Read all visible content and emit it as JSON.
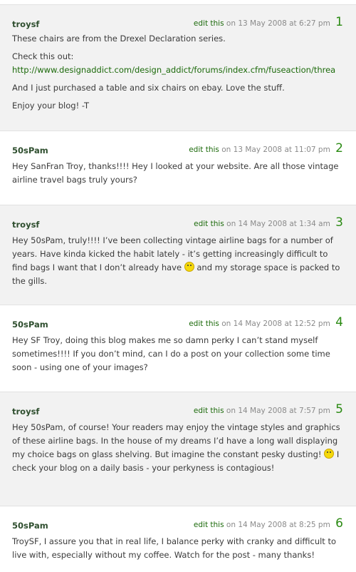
{
  "comments": [
    {
      "author": "troysf",
      "edit_label": "edit this",
      "date": "on 13 May 2008 at 6:27 pm",
      "number": "1",
      "p1": "These chairs are from the Drexel Declaration series.",
      "p2": "Check this out:",
      "link": "http://www.designaddict.com/design_addict/forums/index.cfm/fuseaction/threa",
      "p3": "And I just purchased a table and six chairs on ebay. Love the stuff.",
      "p4": "Enjoy your blog! -T"
    },
    {
      "author": "50sPam",
      "edit_label": "edit this",
      "date": "on 13 May 2008 at 11:07 pm",
      "number": "2",
      "p1": "Hey SanFran Troy, thanks!!!! Hey I looked at your website. Are all those vintage airline travel bags truly yours?"
    },
    {
      "author": "troysf",
      "edit_label": "edit this",
      "date": "on 14 May 2008 at 1:34 am",
      "number": "3",
      "p1a": "Hey 50sPam, truly!!!! I’ve been collecting vintage airline bags for a number of years. Have kinda kicked the habit lately - it’s getting increasingly difficult to find bags I want that I don’t already have",
      "p1b": "and my storage space is packed to the gills."
    },
    {
      "author": "50sPam",
      "edit_label": "edit this",
      "date": "on 14 May 2008 at 12:52 pm",
      "number": "4",
      "p1": "Hey SF Troy, doing this blog makes me so damn perky I can’t stand myself sometimes!!!! If you don’t mind, can I do a post on your collection some time soon - using one of your images?"
    },
    {
      "author": "troysf",
      "edit_label": "edit this",
      "date": "on 14 May 2008 at 7:57 pm",
      "number": "5",
      "p1a": "Hey 50sPam, of course! Your readers may enjoy the vintage styles and graphics of these airline bags. In the house of my dreams I’d have a long wall displaying my choice bags on glass shelving. But imagine the constant pesky dusting!",
      "p1b": "I check your blog on a daily basis - your perkyness is contagious!"
    },
    {
      "author": "50sPam",
      "edit_label": "edit this",
      "date": "on 14 May 2008 at 8:25 pm",
      "number": "6",
      "p1": "TroySF, I assure you that in real life, I balance perky with cranky and difficult to live with, especially without my coffee. Watch for the post - many thanks!"
    }
  ]
}
